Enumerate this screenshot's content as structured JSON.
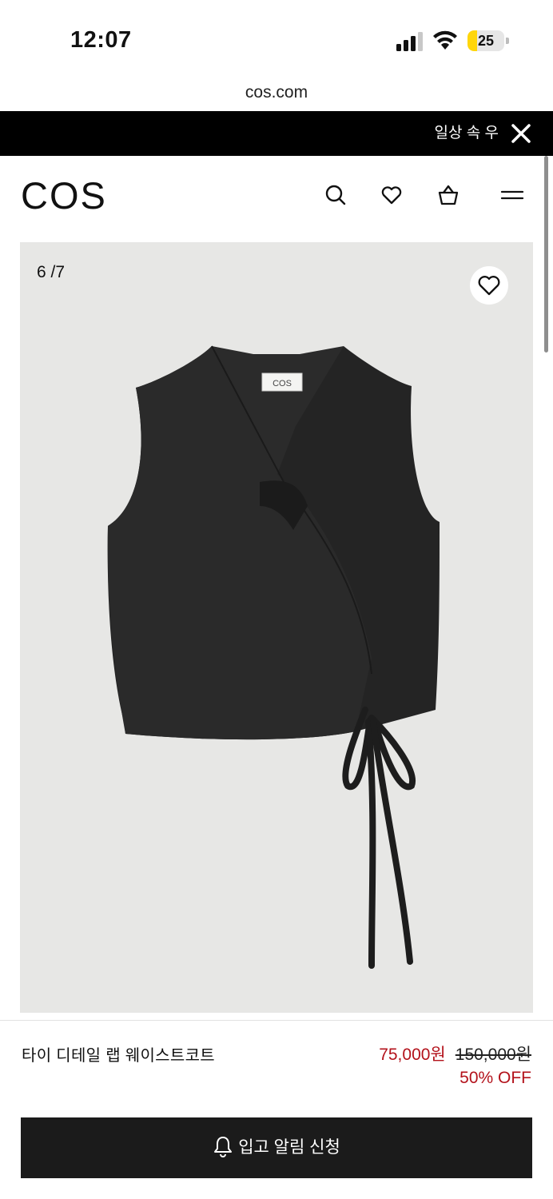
{
  "status_bar": {
    "time": "12:07",
    "battery": "25",
    "battery_level": 0.25
  },
  "browser": {
    "url": "cos.com"
  },
  "announcement": {
    "text": "일상 속 우"
  },
  "header": {
    "logo": "COS"
  },
  "product_image": {
    "counter": "6 /7",
    "label_text": "COS"
  },
  "product": {
    "name": "타이 디테일 랩 웨이스트코트",
    "sale_price": "75,000원",
    "original_price": "150,000원",
    "discount": "50% OFF"
  },
  "cta": {
    "label": "입고 알림 신청"
  },
  "colors": {
    "sale": "#b3121b",
    "button": "#1b1b1b",
    "announce_bg": "#000000",
    "image_bg": "#e7e7e5"
  },
  "icons": [
    "signal-icon",
    "wifi-icon",
    "battery-icon",
    "close-icon",
    "search-icon",
    "heart-icon",
    "bag-icon",
    "menu-icon",
    "bell-icon"
  ]
}
